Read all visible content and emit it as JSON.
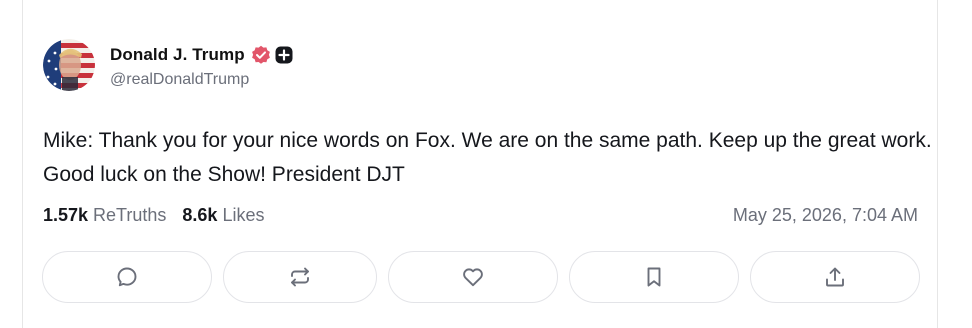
{
  "post": {
    "author": {
      "display_name": "Donald J. Trump",
      "handle": "@realDonaldTrump",
      "verified": true,
      "badge": "plus-badge-icon"
    },
    "text": "Mike: Thank you for your nice words on Fox. We are on the same path. Keep up the great work. Good luck on the Show! President DJT",
    "stats": {
      "retruths_count": "1.57k",
      "retruths_label": "ReTruths",
      "likes_count": "8.6k",
      "likes_label": "Likes"
    },
    "timestamp": "May 25, 2026, 7:04 AM"
  },
  "actions": [
    {
      "name": "reply",
      "icon": "comment-icon"
    },
    {
      "name": "retruth",
      "icon": "repost-icon"
    },
    {
      "name": "like",
      "icon": "heart-icon"
    },
    {
      "name": "bookmark",
      "icon": "bookmark-icon"
    },
    {
      "name": "share",
      "icon": "share-icon"
    }
  ],
  "colors": {
    "verified_badge": "#e2566a",
    "text_primary": "#15171c",
    "text_secondary": "#6b6f7a",
    "border": "#e3e4e8"
  }
}
